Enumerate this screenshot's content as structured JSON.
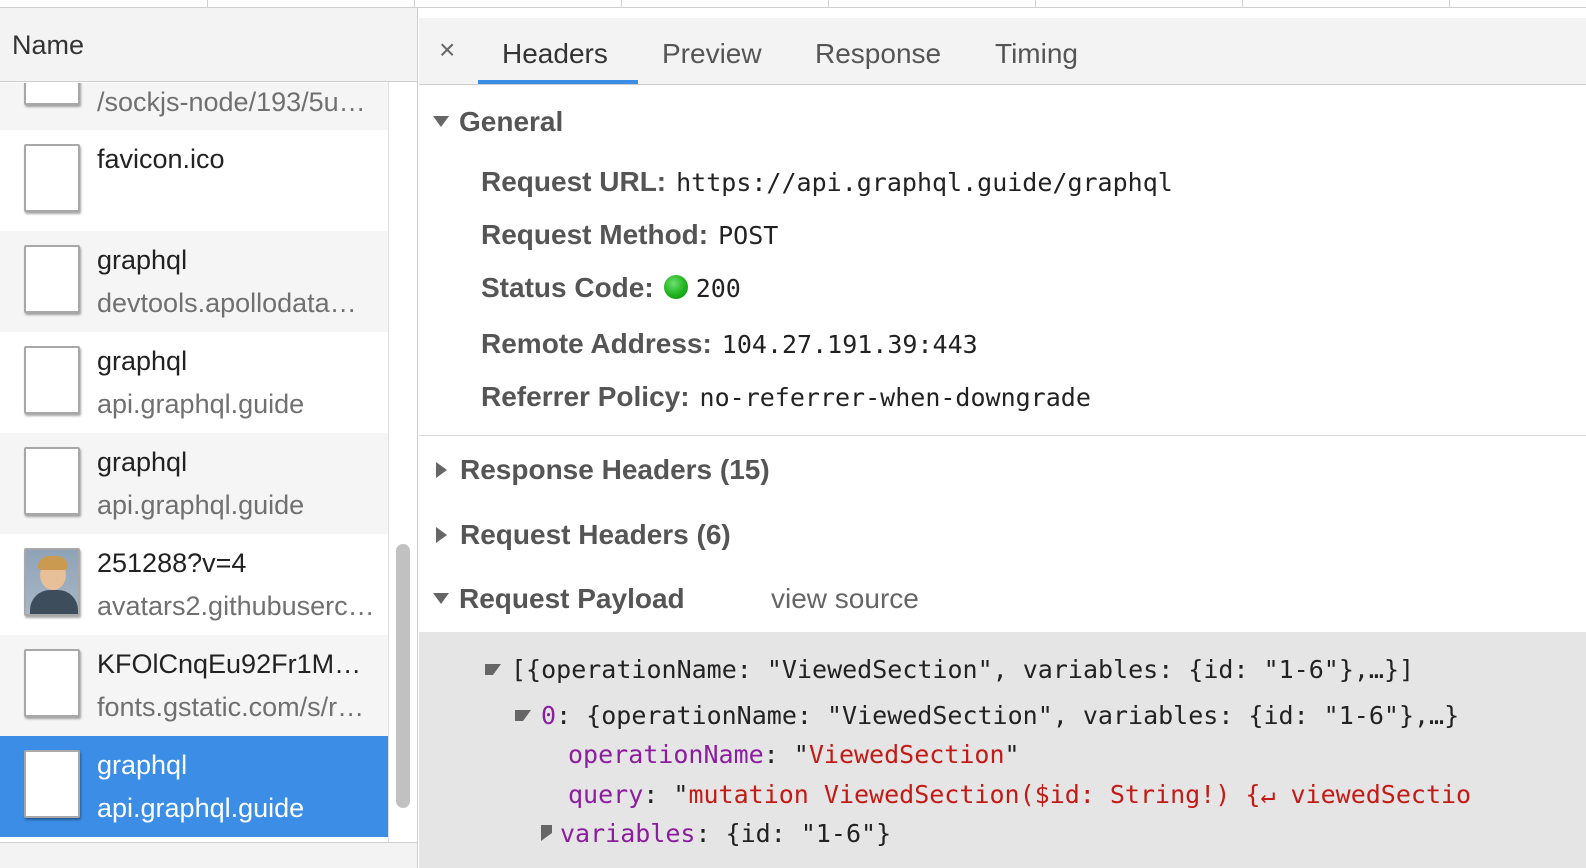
{
  "network_list": {
    "column_header": "Name",
    "requests": [
      {
        "name": "/sockjs-node/193/5u…",
        "domain": ""
      },
      {
        "name": "favicon.ico",
        "domain": ""
      },
      {
        "name": "graphql",
        "domain": "devtools.apollodata…"
      },
      {
        "name": "graphql",
        "domain": "api.graphql.guide"
      },
      {
        "name": "graphql",
        "domain": "api.graphql.guide"
      },
      {
        "name": "251288?v=4",
        "domain": "avatars2.githubuserc…"
      },
      {
        "name": "KFOlCnqEu92Fr1M…",
        "domain": "fonts.gstatic.com/s/r…"
      },
      {
        "name": "graphql",
        "domain": "api.graphql.guide"
      }
    ]
  },
  "detail_tabs": {
    "close": "×",
    "tabs": [
      "Headers",
      "Preview",
      "Response",
      "Timing"
    ],
    "active": "Headers"
  },
  "general": {
    "title": "General",
    "request_url_label": "Request URL:",
    "request_url": "https://api.graphql.guide/graphql",
    "request_method_label": "Request Method:",
    "request_method": "POST",
    "status_code_label": "Status Code:",
    "status_code": "200",
    "status_color": "#1eb21e",
    "remote_address_label": "Remote Address:",
    "remote_address": "104.27.191.39:443",
    "referrer_policy_label": "Referrer Policy:",
    "referrer_policy": "no-referrer-when-downgrade"
  },
  "sections": {
    "response_headers": "Response Headers (15)",
    "request_headers": "Request Headers (6)",
    "request_payload": "Request Payload",
    "view_source": "view source"
  },
  "payload": {
    "root": "[{operationName: \"ViewedSection\", variables: {id: \"1-6\"},…}]",
    "item_index": "0",
    "item_summary": "{operationName: \"ViewedSection\", variables: {id: \"1-6\"},…}",
    "operationName_key": "operationName",
    "operationName_value": "\"ViewedSection\"",
    "query_key": "query",
    "query_value_open": "\"",
    "query_value": "mutation ViewedSection($id: String!) {↵  viewedSectio",
    "variables_key": "variables",
    "variables_value": "{id: \"1-6\"}"
  },
  "colors": {
    "selected_row": "#3b8de6",
    "tab_underline": "#3b8de6",
    "payload_key": "#8b1d9e",
    "payload_string": "#c41a16"
  }
}
